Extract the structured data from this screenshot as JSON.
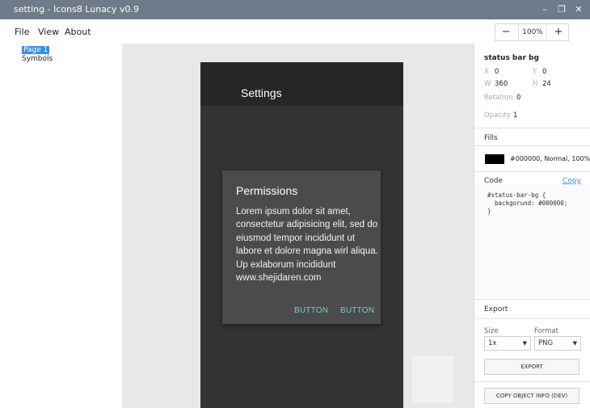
{
  "window": {
    "title": "setting - Icons8 Lunacy v0.9",
    "min_glyph": "–",
    "max_glyph": "❐",
    "close_glyph": "✕"
  },
  "menu": {
    "file": "File",
    "view": "View",
    "about": "About"
  },
  "zoom": {
    "minus": "−",
    "value": "100%",
    "plus": "+"
  },
  "pages": {
    "selected": "Page 1",
    "symbols": "Symbols"
  },
  "canvas": {
    "phone_title": "Settings",
    "dialog": {
      "title": "Permissions",
      "body": "Lorem ipsum dolor sit amet, consectetur adipisicing elit, sed do eiusmod tempor incididunt ut labore et dolore magna wirl aliqua. Up exlaborum incididunt www.shejidaren.com",
      "button1": "BUTTON",
      "button2": "BUTTON"
    }
  },
  "inspector": {
    "layer_name": "status bar bg",
    "x_label": "X",
    "x_value": "0",
    "y_label": "Y",
    "y_value": "0",
    "w_label": "W",
    "w_value": "360",
    "h_label": "H",
    "h_value": "24",
    "rotation_label": "Rotation",
    "rotation_value": "0",
    "opacity_label": "Opacity",
    "opacity_value": "1",
    "fills_title": "Fills",
    "fill_desc": "#000000, Normal, 100%",
    "fill_color": "#000000",
    "code_title": "Code",
    "copy": "Copy",
    "code": "#status-bar-bg {\n  backgorund: #000000;\n}",
    "export_title": "Export",
    "size_label": "Size",
    "size_value": "1x",
    "format_label": "Format",
    "format_value": "PNG",
    "export_button": "EXPORT",
    "copy_info_button": "COPY OBJECT INFO (DEV)"
  }
}
